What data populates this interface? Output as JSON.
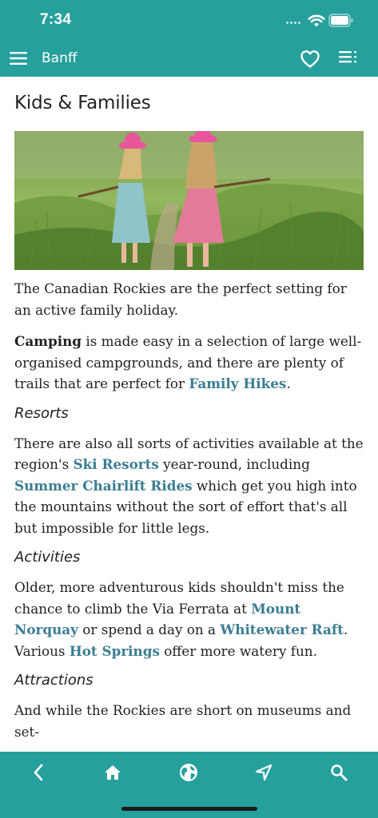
{
  "status_bar": {
    "time": "7:34"
  },
  "nav": {
    "title": "Banff",
    "menu_icon": "hamburger-icon",
    "favorite_icon": "heart-icon",
    "toc_icon": "list-icon"
  },
  "page": {
    "title": "Kids & Families",
    "hero_image": "Two girls in pink sun hats walking through tall green grass",
    "intro": "The Canadian Rockies are the perfect setting for an active family holiday.",
    "camping": {
      "bold": "Camping",
      "text_1": " is made easy in a selection of large well-organised campgrounds, and there are plenty of trails that are perfect for ",
      "link": "Family Hikes",
      "text_2": "."
    },
    "resorts": {
      "heading": "Resorts",
      "text_1": "There are also all sorts of activities available at the region's ",
      "link_1": "Ski Resorts",
      "text_2": " year-round, including ",
      "link_2": "Summer Chairlift Rides",
      "text_3": " which get you high into the mountains without the sort of effort that's all but impossible for little legs."
    },
    "activities": {
      "heading": "Activities",
      "text_1": "Older, more adventurous kids shouldn't miss the chance to climb the Via Ferrata at ",
      "link_1": "Mount Norquay",
      "text_2": " or spend a day on a ",
      "link_2": "Whitewater Raft",
      "text_3": ". Various ",
      "link_3": "Hot Springs",
      "text_4": " offer more watery fun."
    },
    "attractions": {
      "heading": "Attractions",
      "text_1": "And while the Rockies are short on museums and set-"
    }
  },
  "bottom_bar": {
    "items": [
      "back-icon",
      "home-icon",
      "globe-icon",
      "navigate-icon",
      "search-icon"
    ]
  },
  "colors": {
    "brand": "#26a09c",
    "link": "#3b7d93",
    "text": "#222222"
  }
}
